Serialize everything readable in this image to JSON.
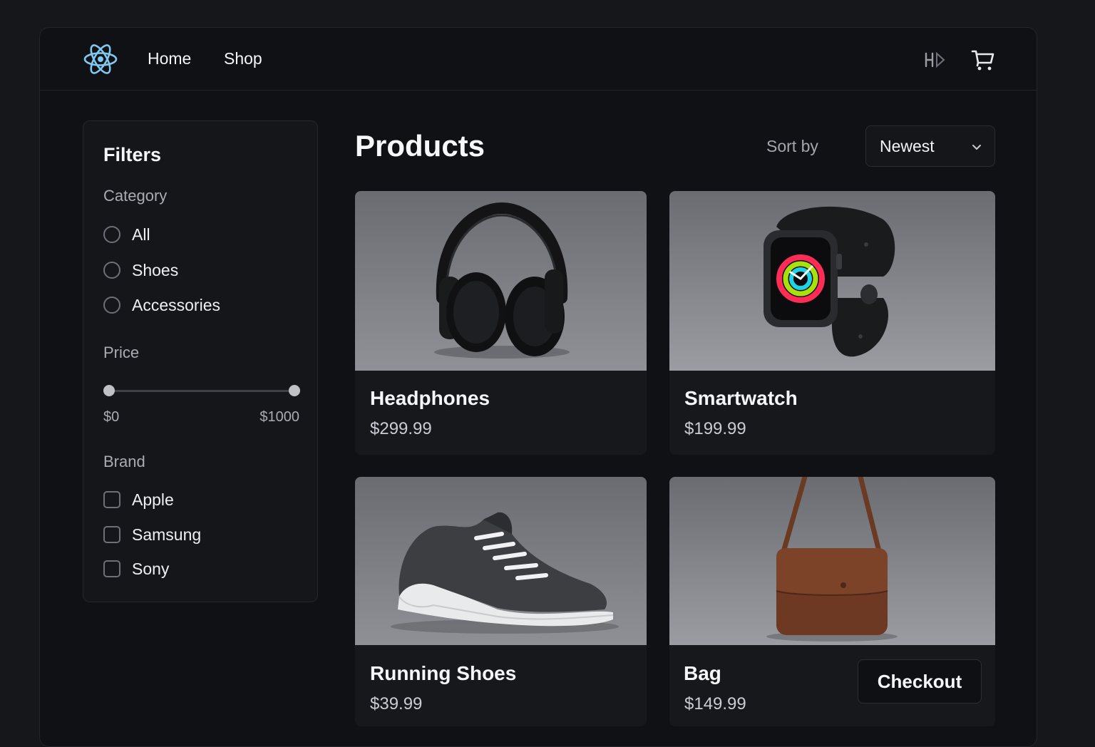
{
  "header": {
    "logo_icon": "react-atom-logo-icon",
    "nav": [
      {
        "label": "Home"
      },
      {
        "label": "Shop"
      }
    ],
    "theme_toggle_icon": "theme-toggle-icon",
    "cart_icon": "cart-icon",
    "accent_color": "#7fc8f0"
  },
  "filters": {
    "title": "Filters",
    "category": {
      "label": "Category",
      "options": [
        {
          "label": "All"
        },
        {
          "label": "Shoes"
        },
        {
          "label": "Accessories"
        }
      ]
    },
    "price": {
      "label": "Price",
      "min_label": "$0",
      "max_label": "$1000",
      "range_min_fraction": 0.0,
      "range_max_fraction": 1.0
    },
    "brand": {
      "label": "Brand",
      "options": [
        {
          "label": "Apple"
        },
        {
          "label": "Samsung"
        },
        {
          "label": "Sony"
        }
      ]
    }
  },
  "main": {
    "title": "Products",
    "sort": {
      "label": "Sort by",
      "selected": "Newest"
    },
    "products": [
      {
        "name": "Headphones",
        "price": "$299.99",
        "image_icon": "headphones-image"
      },
      {
        "name": "Smartwatch",
        "price": "$199.99",
        "image_icon": "smartwatch-image"
      },
      {
        "name": "Running Shoes",
        "price": "$39.99",
        "image_icon": "sneaker-image"
      },
      {
        "name": "Bag",
        "price": "$149.99",
        "image_icon": "handbag-image"
      }
    ],
    "checkout_label": "Checkout"
  }
}
